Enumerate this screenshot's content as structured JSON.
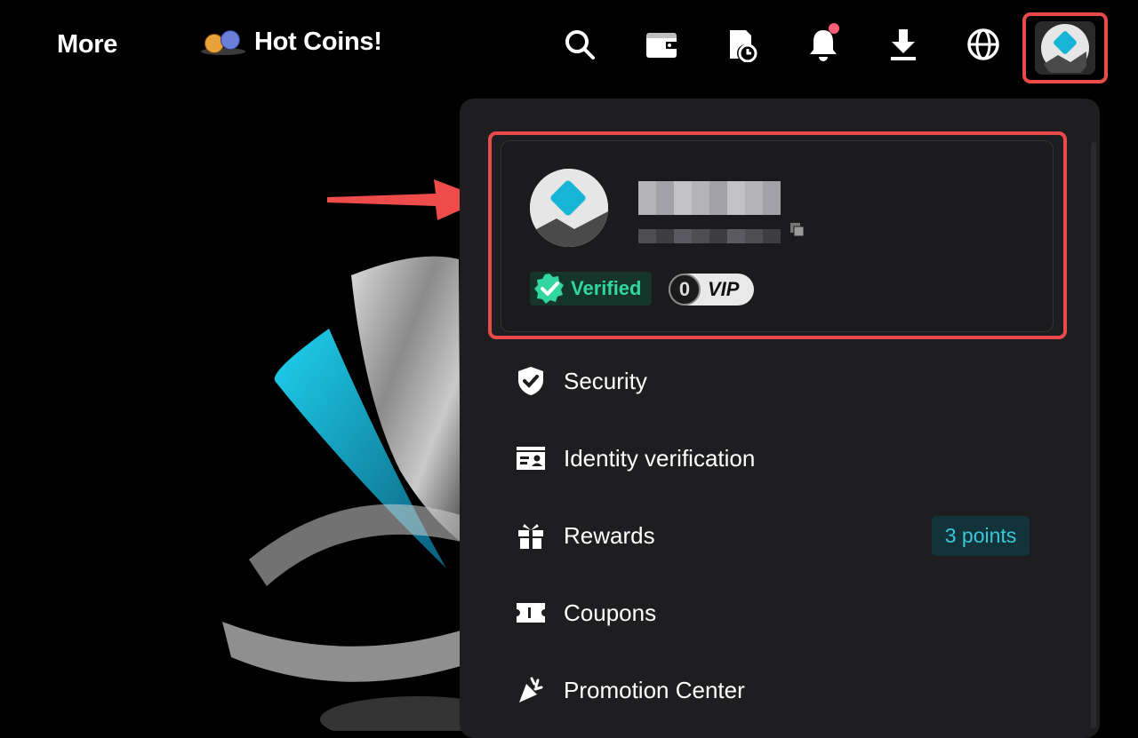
{
  "nav": {
    "more_label": "More",
    "hot_coins_label": "Hot Coins!",
    "icons": [
      "search-icon",
      "wallet-icon",
      "order-history-icon",
      "bell-icon",
      "download-icon",
      "globe-icon",
      "avatar-icon"
    ]
  },
  "profile": {
    "verified_label": "Verified",
    "vip_level": "0",
    "vip_label": "VIP"
  },
  "menu": {
    "items": [
      {
        "label": "Security",
        "icon": "shield-check-icon"
      },
      {
        "label": "Identity verification",
        "icon": "id-card-icon"
      },
      {
        "label": "Rewards",
        "icon": "gift-icon"
      },
      {
        "label": "Coupons",
        "icon": "ticket-icon"
      },
      {
        "label": "Promotion Center",
        "icon": "party-popper-icon"
      }
    ],
    "rewards_points": "3 points"
  },
  "colors": {
    "highlight": "#e94a4a",
    "verified_green": "#32d6a0",
    "points_teal": "#3cc7d8",
    "brand_cyan": "#16b5d6"
  }
}
